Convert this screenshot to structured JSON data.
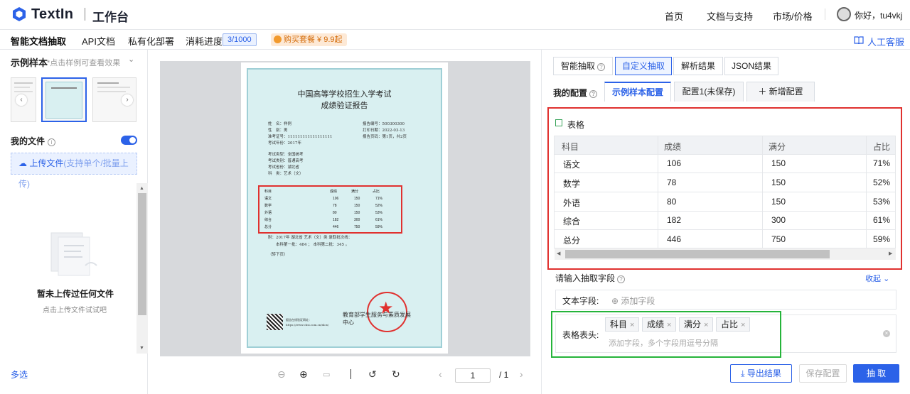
{
  "header": {
    "brand": "TextIn",
    "workbench": "工作台",
    "nav": [
      "首页",
      "文档与支持",
      "市场/价格"
    ],
    "greeting": "你好，tu4vkj"
  },
  "subbar": {
    "items": [
      "智能文档抽取",
      "API文档",
      "私有化部署",
      "消耗进度"
    ],
    "quota": "3/1000",
    "buy": "购买套餐 ¥ 9.9起",
    "support": "人工客服"
  },
  "left": {
    "samples_title": "示例样本",
    "samples_hint": "*点击样例可查看效果",
    "my_files": "我的文件",
    "upload_label": "上传文件",
    "upload_hint": "(支持单个/批量上传)",
    "empty_title": "暂未上传过任何文件",
    "empty_sub": "点击上传文件试试吧",
    "multi": "多选"
  },
  "document": {
    "title1": "中国高等学校招生入学考试",
    "title2": "成绩验证报告",
    "left_lines": [
      "姓　名：样例",
      "性　别：男",
      "准考证号：111111111111111111",
      "考试年份：2017年",
      "",
      "考试类型：全国统考",
      "考试类别：普通高考",
      "考试省份：湖北省",
      "科　类：艺术（文）"
    ],
    "right_lines": [
      "报告编号：500300300",
      "打印日期：2022-03-13",
      "报告页码：第1页，共2页"
    ],
    "table_head": [
      "科目",
      "成绩",
      "满分",
      "占比"
    ],
    "table_rows": [
      [
        "语文",
        "106",
        "150",
        "71%"
      ],
      [
        "数学",
        "78",
        "150",
        "52%"
      ],
      [
        "外语",
        "80",
        "150",
        "53%"
      ],
      [
        "综合",
        "182",
        "300",
        "61%"
      ],
      [
        "总分",
        "446",
        "750",
        "59%"
      ]
    ],
    "note1": "附：2017年 湖北省 艺术（文）类 录取批次线：",
    "note2": "本科第一批：484 ； 本科第二批：345 。",
    "note3": "（转下页）",
    "seal_text": "教育部学生服务与素质发展中心",
    "qr_text": "报告在线验证网址：https://www.chsi.com.cn/xlcx/"
  },
  "viewer": {
    "page": "1",
    "total": "/ 1"
  },
  "right": {
    "tabs": [
      "智能抽取",
      "自定义抽取",
      "解析结果",
      "JSON结果"
    ],
    "my_config": "我的配置",
    "config_tabs": [
      "示例样本配置",
      "配置1(未保存)",
      "新增配置"
    ],
    "table_label": "表格",
    "columns": [
      "科目",
      "成绩",
      "满分",
      "占比"
    ],
    "rows": [
      [
        "语文",
        "106",
        "150",
        "71%"
      ],
      [
        "数学",
        "78",
        "150",
        "52%"
      ],
      [
        "外语",
        "80",
        "150",
        "53%"
      ],
      [
        "综合",
        "182",
        "300",
        "61%"
      ],
      [
        "总分",
        "446",
        "750",
        "59%"
      ]
    ],
    "field_prompt": "请输入抽取字段",
    "collapse": "收起",
    "text_field_label": "文本字段:",
    "text_field_add": "添加字段",
    "header_field_label": "表格表头:",
    "header_tags": [
      "科目",
      "成绩",
      "满分",
      "占比"
    ],
    "header_placeholder": "添加字段，多个字段用逗号分隔",
    "buttons": {
      "export": "导出结果",
      "save": "保存配置",
      "extract": "抽 取"
    }
  }
}
